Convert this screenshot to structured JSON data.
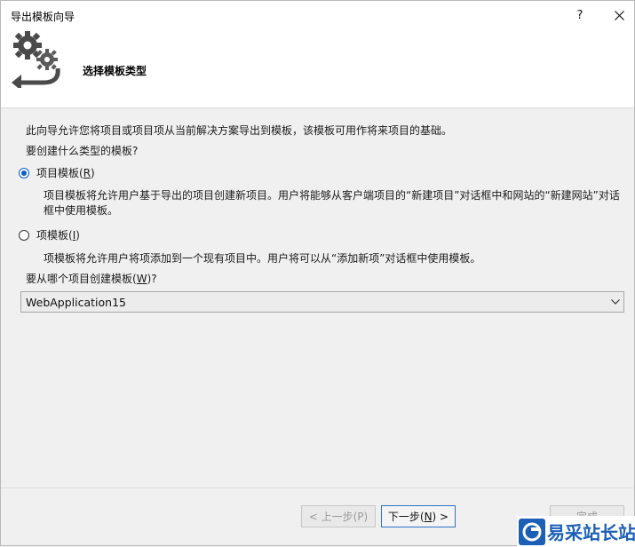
{
  "window": {
    "title": "导出模板向导",
    "help_label": "?"
  },
  "header": {
    "title": "选择模板类型",
    "icon": "gears-arrow-icon"
  },
  "intro": "此向导允许您将项目或项目项从当前解决方案导出到模板，该模板可用作将来项目的基础。",
  "question": "要创建什么类型的模板?",
  "options": [
    {
      "label": "项目模板",
      "accel": "R",
      "checked": true,
      "description": "项目模板将允许用户基于导出的项目创建新项目。用户将能够从客户端项目的“新建项目”对话框中和网站的“新建网站”对话框中使用模板。"
    },
    {
      "label": "项模板",
      "accel": "I",
      "checked": false,
      "description": "项模板将允许用户将项添加到一个现有项目中。用户将可以从“添加新项”对话框中使用模板。"
    }
  ],
  "project_prompt": {
    "text": "要从哪个项目创建模板",
    "accel": "W",
    "suffix": "?"
  },
  "project_select": {
    "value": "WebApplication15"
  },
  "buttons": {
    "prev": "< 上一步(P)",
    "next_prefix": "下一步(",
    "next_accel": "N",
    "next_suffix": ") >",
    "finish": "完成"
  },
  "watermark": {
    "text": "易采站长站"
  },
  "colors": {
    "accent": "#0a5fc4",
    "next_border": "#2c72c7",
    "disabled_text": "#9a9a9a",
    "watermark": "#1c5fb6"
  }
}
